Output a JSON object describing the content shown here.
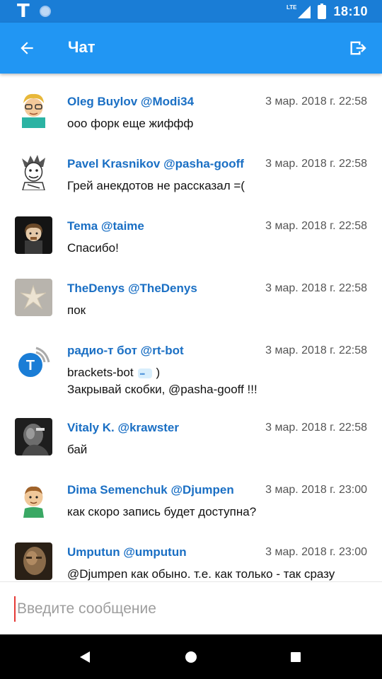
{
  "status_bar": {
    "app_icon": "T",
    "network": "LTE",
    "time": "18:10"
  },
  "toolbar": {
    "title": "Чат",
    "back_icon": "arrow-left-icon",
    "exit_icon": "exit-icon"
  },
  "messages": [
    {
      "author": "Oleg Buylov @Modi34",
      "date": "3 мар. 2018 г. 22:58",
      "text": "ооо форк еще жиффф"
    },
    {
      "author": "Pavel Krasnikov @pasha-gooff",
      "date": "3 мар. 2018 г. 22:58",
      "text": "Грей анекдотов не рассказал =("
    },
    {
      "author": "Tema @taime",
      "date": "3 мар. 2018 г. 22:58",
      "text": "Спасибо!"
    },
    {
      "author": "TheDenys @TheDenys",
      "date": "3 мар. 2018 г. 22:58",
      "text": "пок"
    },
    {
      "author": "радио-т бот @rt-bot",
      "date": "3 мар. 2018 г. 22:58",
      "text": "brackets-bot",
      "text_suffix": ")",
      "text2": "Закрывай скобки, @pasha-gooff !!!"
    },
    {
      "author": "Vitaly K. @krawster",
      "date": "3 мар. 2018 г. 22:58",
      "text": "бай"
    },
    {
      "author": "Dima Semenchuk @Djumpen",
      "date": "3 мар. 2018 г. 23:00",
      "text": "как скоро запись будет доступна?"
    },
    {
      "author": "Umputun @umputun",
      "date": "3 мар. 2018 г. 23:00",
      "text": "@Djumpen как обыно. т.е. как только - так сразу"
    }
  ],
  "input": {
    "placeholder": "Введите сообщение",
    "value": ""
  },
  "colors": {
    "status_bar": "#1a7dd6",
    "toolbar": "#2196f3",
    "author": "#1a6fc4",
    "cursor": "#e53935"
  }
}
